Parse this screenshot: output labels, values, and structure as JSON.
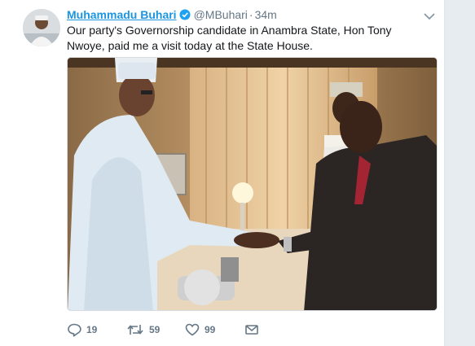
{
  "tweet": {
    "author_name": "Muhammadu Buhari",
    "handle": "@MBuhari",
    "separator": "·",
    "time": "34m",
    "text": "Our party's Governorship candidate in Anambra State, Hon Tony Nwoye, paid me a visit today at the State House."
  },
  "actions": {
    "reply_count": "19",
    "retweet_count": "59",
    "like_count": "99"
  },
  "icons": {
    "reply": "reply-icon",
    "retweet": "retweet-icon",
    "like": "heart-icon",
    "message": "envelope-icon",
    "verified": "verified-badge-icon",
    "more": "chevron-down-icon"
  },
  "colors": {
    "link": "#1b95e0",
    "muted": "#657786",
    "text": "#14171a"
  }
}
